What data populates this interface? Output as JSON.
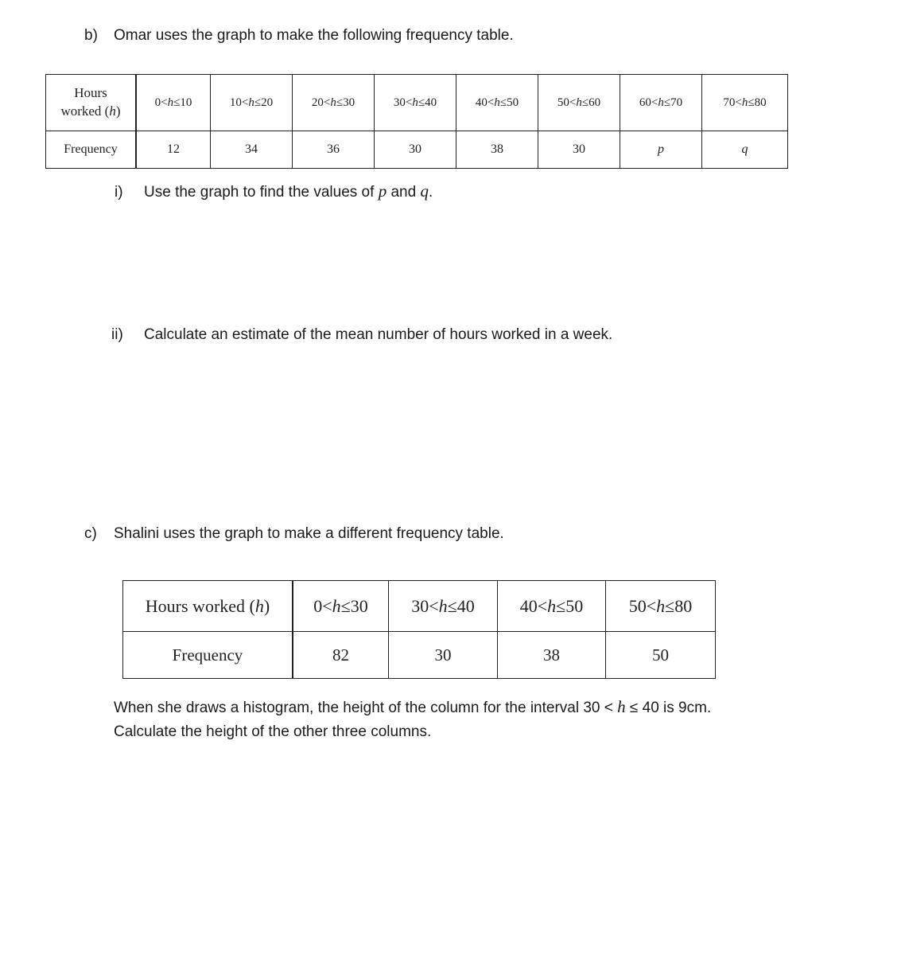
{
  "part_b": {
    "label": "b)",
    "text": "Omar uses the graph to make the following frequency table.",
    "table": {
      "row_headers": {
        "hours_line1": "Hours",
        "hours_line2": "worked (",
        "hours_var": "h",
        "hours_close": ")",
        "frequency": "Frequency"
      },
      "intervals": [
        {
          "lo": "0",
          "hi": "10"
        },
        {
          "lo": "10",
          "hi": "20"
        },
        {
          "lo": "20",
          "hi": "30"
        },
        {
          "lo": "30",
          "hi": "40"
        },
        {
          "lo": "40",
          "hi": "50"
        },
        {
          "lo": "50",
          "hi": "60"
        },
        {
          "lo": "60",
          "hi": "70"
        },
        {
          "lo": "70",
          "hi": "80"
        }
      ],
      "frequencies": [
        "12",
        "34",
        "36",
        "30",
        "38",
        "30",
        "p",
        "q"
      ]
    },
    "sub_i": {
      "label": "i)",
      "text_before": "Use the graph to find the values of ",
      "var_p": "p",
      "text_and": " and ",
      "var_q": "q",
      "text_after": "."
    },
    "sub_ii": {
      "label": "ii)",
      "text": "Calculate an estimate of the mean number of hours worked in a week."
    }
  },
  "part_c": {
    "label": "c)",
    "text": "Shalini uses the graph to make a different frequency table.",
    "table": {
      "row_headers": {
        "hours": "Hours worked (",
        "hours_var": "h",
        "hours_close": ")",
        "frequency": "Frequency"
      },
      "intervals": [
        {
          "lo": "0",
          "hi": "30"
        },
        {
          "lo": "30",
          "hi": "40"
        },
        {
          "lo": "40",
          "hi": "50"
        },
        {
          "lo": "50",
          "hi": "80"
        }
      ],
      "frequencies": [
        "82",
        "30",
        "38",
        "50"
      ]
    },
    "note_line1_before": "When she draws a histogram, the height of the column for the interval 30 < ",
    "note_var": "h",
    "note_line1_after": " ≤ 40 is 9cm.",
    "note_line2": "Calculate the height of the other three columns."
  },
  "symbols": {
    "lt": "<",
    "le": "≤"
  }
}
